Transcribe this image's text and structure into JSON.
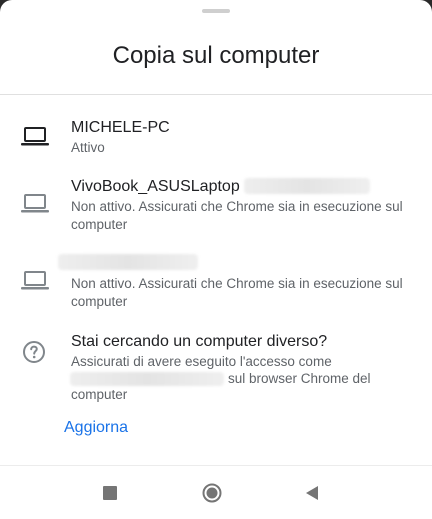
{
  "sheet": {
    "title": "Copia sul computer"
  },
  "devices": [
    {
      "name": "MICHELE-PC",
      "status": "Attivo",
      "icon": "laptop-icon",
      "active": true
    },
    {
      "name": "VivoBook_ASUSLaptop",
      "status": "Non attivo. Assicurati che Chrome sia in esecuzione sul computer",
      "icon": "laptop-icon",
      "active": false
    },
    {
      "name": "",
      "status": "Non attivo. Assicurati che Chrome sia in esecuzione sul computer",
      "icon": "laptop-icon",
      "active": false
    }
  ],
  "help": {
    "icon": "help-circle-icon",
    "title": "Stai cercando un computer diverso?",
    "line1": "Assicurati di avere eseguito l'accesso come",
    "line2_suffix": "sul browser Chrome del",
    "line3": "computer"
  },
  "refresh_label": "Aggiorna",
  "nav": {
    "recents_icon": "square-icon",
    "home_icon": "circle-icon",
    "back_icon": "back-triangle-icon"
  },
  "colors": {
    "accent": "#1a73e8",
    "active_icon": "#202124",
    "inactive_icon": "#80868b"
  }
}
